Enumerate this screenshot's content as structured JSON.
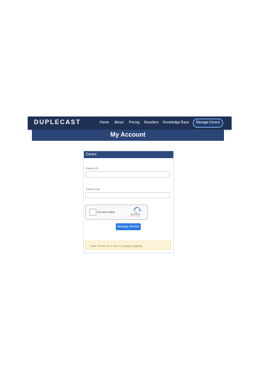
{
  "header": {
    "brand": "DUPLECAST",
    "nav": {
      "home": "Home",
      "about": "About",
      "pricing": "Pricing",
      "resellers": "Resellers",
      "knowledge_base": "Knowledge Base"
    },
    "cta": "Manage Device"
  },
  "hero": {
    "title": "My Account"
  },
  "card": {
    "title": "Device",
    "device_id_label": "Device ID",
    "device_id_value": "",
    "device_key_label": "Device Key",
    "device_key_value": "",
    "recaptcha": {
      "label": "I'm not a robot",
      "brand": "reCAPTCHA",
      "links": "Privacy - Terms"
    },
    "submit_label": "Manage Device",
    "alert": "Enter Device ID & Key to manage playlists."
  },
  "colors": {
    "navbar": "#1f3155",
    "hero": "#2a4576",
    "card_header": "#2d4a7c",
    "button": "#2d7be0",
    "alert_bg": "#fbf3d7",
    "alert_text": "#9c7c2e"
  },
  "icons": {
    "recaptcha_logo": "recaptcha-icon",
    "checkbox": "checkbox-icon"
  }
}
